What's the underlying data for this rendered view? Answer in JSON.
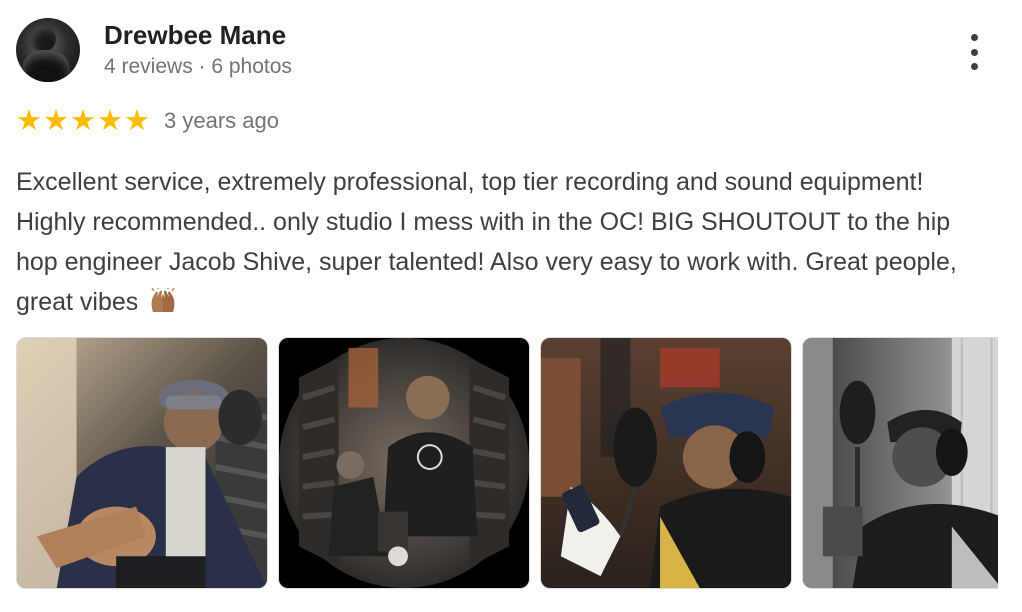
{
  "reviewer": {
    "name": "Drewbee Mane",
    "meta": "4 reviews · 6 photos"
  },
  "rating": {
    "stars": 5,
    "age": "3 years ago",
    "star_color": "#fbbc04"
  },
  "review": {
    "text": "Excellent service, extremely professional, top tier recording and sound equipment! Highly recommended.. only studio I mess with in the OC! BIG SHOUTOUT to the hip hop engineer Jacob Shive, super talented! Also very easy to work with. Great people, great vibes"
  },
  "icons": {
    "more": "more-vert-icon",
    "emoji": "raising-hands-emoji"
  },
  "photos": [
    {
      "name": "photo-1"
    },
    {
      "name": "photo-2"
    },
    {
      "name": "photo-3"
    },
    {
      "name": "photo-4"
    }
  ]
}
